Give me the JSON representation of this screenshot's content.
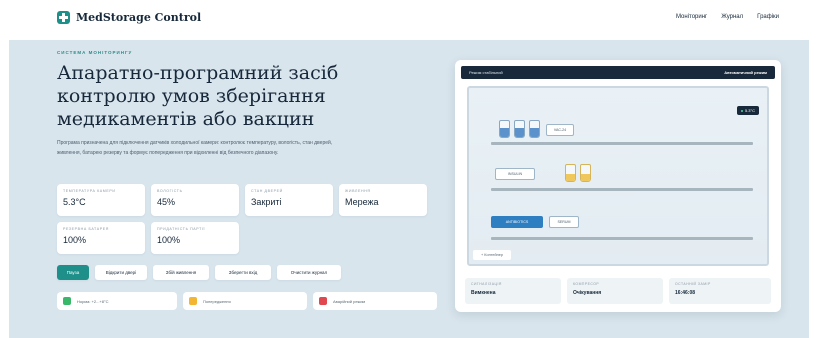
{
  "header": {
    "brand": "MedStorage Control",
    "nav": [
      "Моніторинг",
      "Журнал",
      "Графіки"
    ]
  },
  "hero": {
    "kicker": "Система моніторингу",
    "title": "Апаратно-програмний засіб контролю умов зберігання медикаментів або вакцин",
    "description": "Програма призначена для підключення датчиків холодильної камери: контролює температуру, вологість, стан дверей, живлення, батарею резерву та формує попередження при відхиленні від безпечного діапазону."
  },
  "stats": [
    {
      "label": "Температура камери",
      "value": "5.3°C"
    },
    {
      "label": "Вологість",
      "value": "45%"
    },
    {
      "label": "Стан дверей",
      "value": "Закриті"
    },
    {
      "label": "Живлення",
      "value": "Мережа"
    },
    {
      "label": "Резервна батарея",
      "value": "100%"
    },
    {
      "label": "Придатність партії",
      "value": "100%"
    }
  ],
  "buttons": [
    "Пауза",
    "Відкрити двері",
    "Збій живлення",
    "Зберегти вхід",
    "Очистити журнал"
  ],
  "legend": [
    {
      "label": "Норма: +2...+8°C",
      "color": "#39b86a"
    },
    {
      "label": "Попередження",
      "color": "#f2b632"
    },
    {
      "label": "Аварійний режим",
      "color": "#e0474f"
    }
  ],
  "panel": {
    "header_left": "Режим стабільний",
    "header_right": "Автоматичний режим",
    "temp_badge": "5.3°C",
    "slots": [
      "VAC-24",
      "INSULIN",
      "ANTIBIOTICS",
      "SERUM"
    ],
    "add_label": "+ Контейнер",
    "status": [
      {
        "label": "Сигналізація",
        "value": "Вимкнена"
      },
      {
        "label": "Компресор",
        "value": "Очікування"
      },
      {
        "label": "Останній замір",
        "value": "16:46:08"
      }
    ]
  },
  "vial_levels": [
    0.55,
    0.55,
    0.55,
    0.45,
    0.45
  ],
  "colors": {
    "accent": "#1f8f8a",
    "dark": "#17293a",
    "hero_bg": "#d9e5ed",
    "vial_blue": "#5b92cc",
    "vial_gold": "#f0c75a"
  }
}
